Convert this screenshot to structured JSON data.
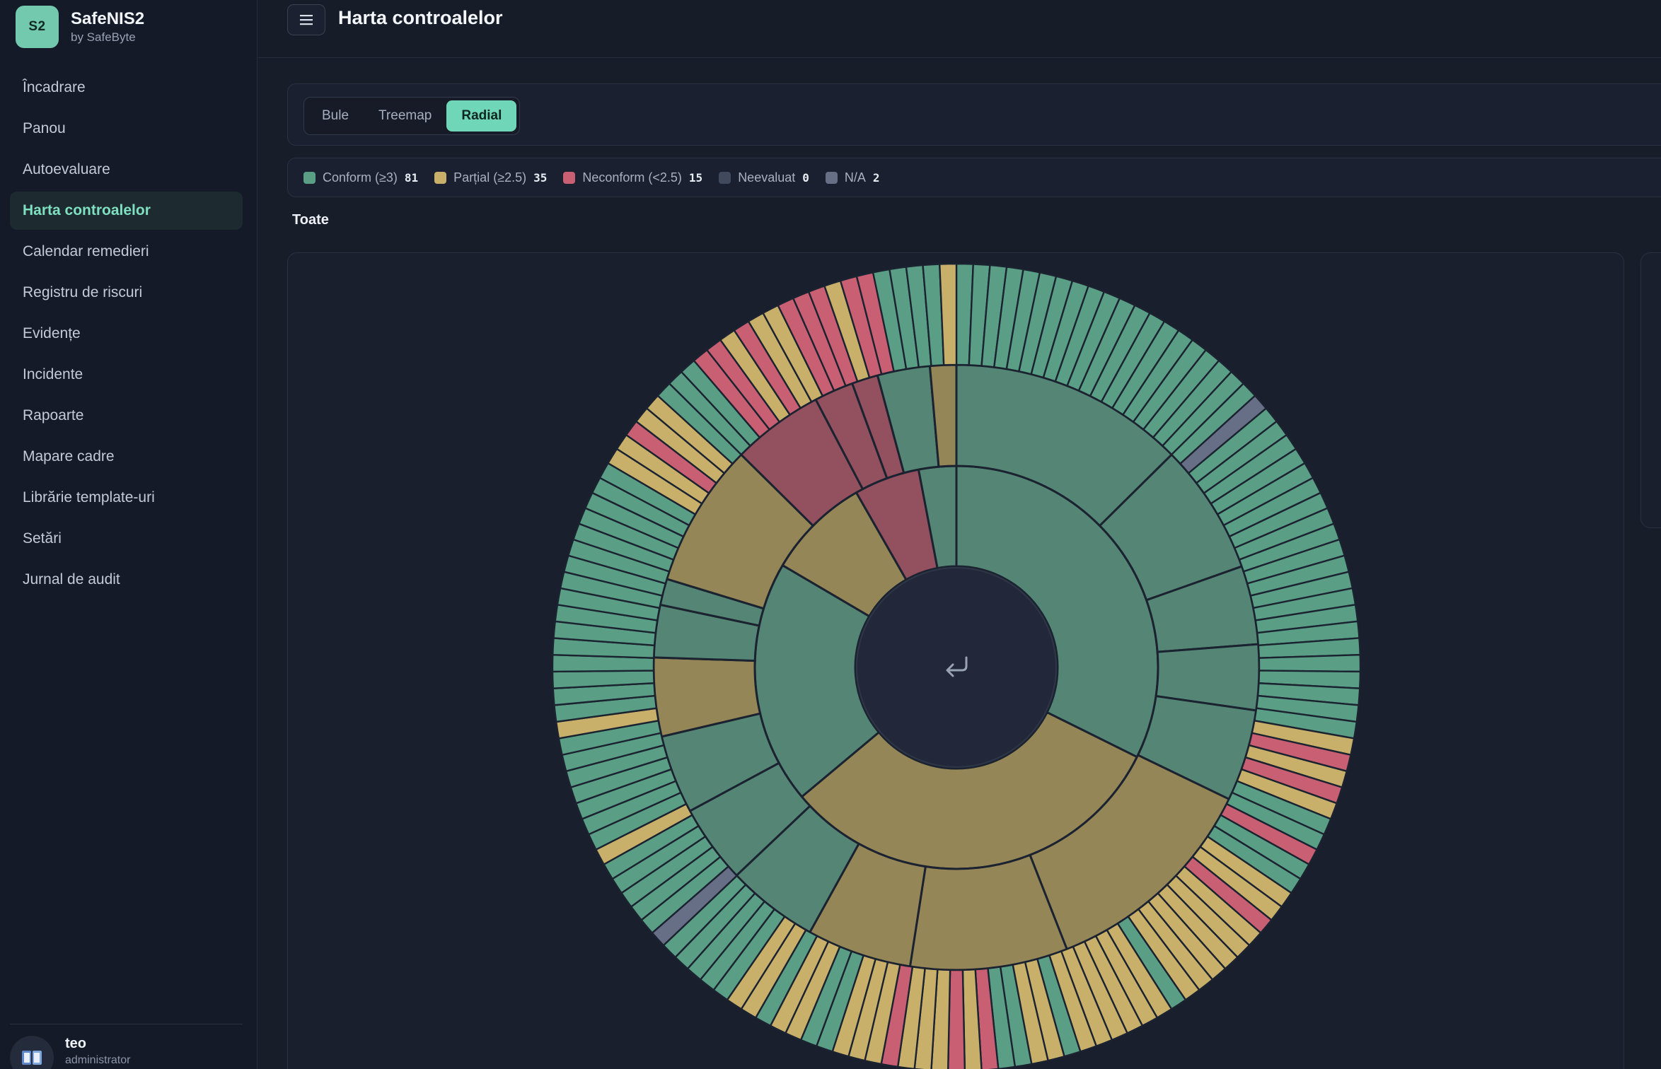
{
  "brand": {
    "logo": "S2",
    "name": "SafeNIS2",
    "sub": "by SafeByte"
  },
  "nav": [
    {
      "label": "Încadrare",
      "active": false
    },
    {
      "label": "Panou",
      "active": false
    },
    {
      "label": "Autoevaluare",
      "active": false
    },
    {
      "label": "Harta controalelor",
      "active": true
    },
    {
      "label": "Calendar remedieri",
      "active": false
    },
    {
      "label": "Registru de riscuri",
      "active": false
    },
    {
      "label": "Evidențe",
      "active": false
    },
    {
      "label": "Incidente",
      "active": false
    },
    {
      "label": "Rapoarte",
      "active": false
    },
    {
      "label": "Mapare cadre",
      "active": false
    },
    {
      "label": "Librărie template-uri",
      "active": false
    },
    {
      "label": "Setări",
      "active": false
    },
    {
      "label": "Jurnal de audit",
      "active": false
    }
  ],
  "user": {
    "name": "teo",
    "role": "administrator",
    "avatar_icon": "book-icon"
  },
  "header": {
    "title": "Harta controalelor",
    "menu_icon": "hamburger-icon"
  },
  "view_switch": {
    "options": [
      "Bule",
      "Treemap",
      "Radial"
    ],
    "selected": "Radial"
  },
  "legend": [
    {
      "label": "Conform (≥3)",
      "count": "81",
      "color": "#5a9e85"
    },
    {
      "label": "Parțial (≥2.5)",
      "count": "35",
      "color": "#c9b06a"
    },
    {
      "label": "Neconform (<2.5)",
      "count": "15",
      "color": "#c95f72"
    },
    {
      "label": "Neevaluat",
      "count": "0",
      "color": "#414a5c"
    },
    {
      "label": "N/A",
      "count": "2",
      "color": "#676f87"
    }
  ],
  "filter": {
    "label": "Toate"
  },
  "center_icon": "return-arrow-icon",
  "colors": {
    "conform": "#5a9e85",
    "partial": "#c9b06a",
    "nonconform": "#c95f72",
    "na": "#676f87",
    "conform_dim": "#558675",
    "partial_dim": "#958657",
    "nonconform_dim": "#93505f",
    "center": "#222839",
    "stroke": "#1b2230"
  },
  "chart_data": {
    "type": "sunburst",
    "levels": [
      "categorii",
      "domenii",
      "controale"
    ],
    "inner_ring": [
      {
        "status": "conform",
        "value": 43
      },
      {
        "status": "partial",
        "value": 42
      },
      {
        "status": "conform",
        "value": 26
      },
      {
        "status": "partial",
        "value": 11
      },
      {
        "status": "nonconform",
        "value": 7
      },
      {
        "status": "conform",
        "value": 4
      }
    ],
    "middle_ring": [
      {
        "status": "conform",
        "value": 18
      },
      {
        "status": "conform",
        "value": 10
      },
      {
        "status": "conform",
        "value": 6
      },
      {
        "status": "conform",
        "value": 5
      },
      {
        "status": "conform",
        "value": 7
      },
      {
        "status": "partial",
        "value": 17
      },
      {
        "status": "partial",
        "value": 12
      },
      {
        "status": "partial",
        "value": 8
      },
      {
        "status": "conform",
        "value": 7
      },
      {
        "status": "conform",
        "value": 6
      },
      {
        "status": "conform",
        "value": 6
      },
      {
        "status": "partial",
        "value": 6
      },
      {
        "status": "conform",
        "value": 4
      },
      {
        "status": "conform",
        "value": 2
      },
      {
        "status": "partial",
        "value": 11
      },
      {
        "status": "nonconform",
        "value": 7
      },
      {
        "status": "nonconform",
        "value": 3
      },
      {
        "status": "nonconform",
        "value": 2
      },
      {
        "status": "conform",
        "value": 4
      },
      {
        "status": "partial",
        "value": 2
      }
    ],
    "outer_ring": "CCCCCCCCCCCCCCCCCCCCNCCCCCCCCCCCCCCCCCCCCCPRPRPCCRCCPPRPPPPPPCPPPPPPCPPCCRPRPPPRPPPCCPPCPPCCCCCNCCCCCPCCCCCCCPCCCCCCCCCCCCCCCCPPRPPCCCRRPRPPRRRPRRCCCCP",
    "outer_ring_legend": {
      "C": "conform",
      "P": "partial",
      "R": "nonconform",
      "N": "na"
    },
    "totals": {
      "conform": 81,
      "partial": 35,
      "nonconform": 15,
      "not_evaluated": 0,
      "na": 2
    }
  }
}
